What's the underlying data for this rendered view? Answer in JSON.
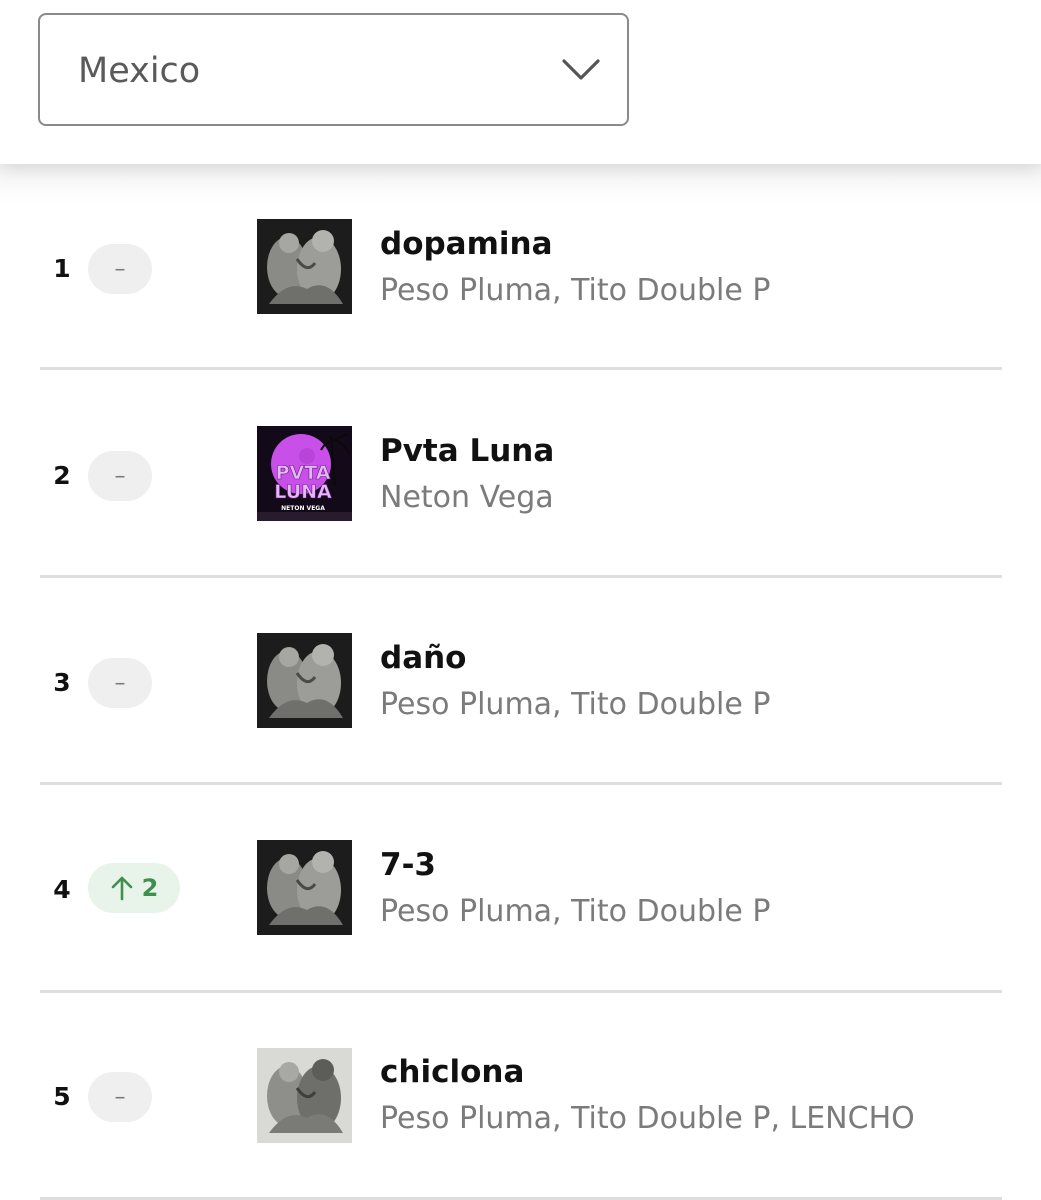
{
  "country_select": {
    "value": "Mexico"
  },
  "chart": [
    {
      "rank": "1",
      "movement": "flat",
      "movement_label": "–",
      "title": "dopamina",
      "artists": "Peso Pluma, Tito Double P",
      "cover": "statue-dark"
    },
    {
      "rank": "2",
      "movement": "flat",
      "movement_label": "–",
      "title": "Pvta Luna",
      "artists": "Neton Vega",
      "cover": "pvta-luna",
      "cover_text": {
        "line1": "PVTA",
        "line2": "LUNA",
        "artist": "NETON VEGA"
      }
    },
    {
      "rank": "3",
      "movement": "flat",
      "movement_label": "–",
      "title": "daño",
      "artists": "Peso Pluma, Tito Double P",
      "cover": "statue-dark"
    },
    {
      "rank": "4",
      "movement": "up",
      "movement_label": "2",
      "title": "7-3",
      "artists": "Peso Pluma, Tito Double P",
      "cover": "statue-dark"
    },
    {
      "rank": "5",
      "movement": "flat",
      "movement_label": "–",
      "title": "chiclona",
      "artists": "Peso Pluma, Tito Double P, LENCHO",
      "cover": "statue-light"
    }
  ],
  "colors": {
    "up_badge_bg": "#e8f4ea",
    "up_badge_fg": "#3f8f4f",
    "flat_badge_bg": "#efefef",
    "cover_accent": "#c84fe8"
  }
}
